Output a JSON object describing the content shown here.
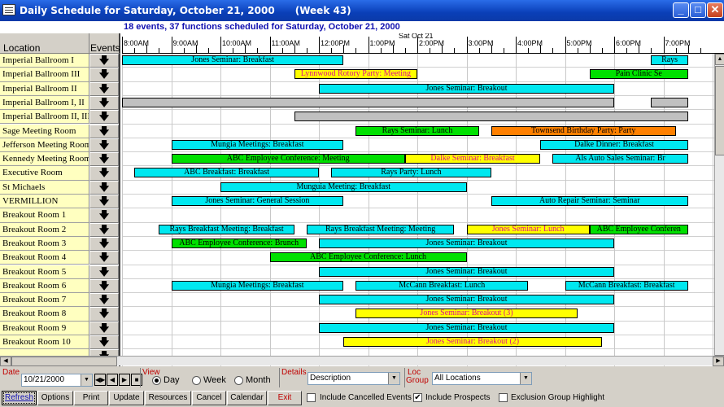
{
  "window": {
    "title": "Daily Schedule for Saturday, October 21, 2000      (Week 43)",
    "min": "_",
    "max": "□",
    "close": "✕"
  },
  "summary": "18 events, 37 functions scheduled for Saturday, October 21, 2000",
  "header": {
    "location": "Location",
    "events": "Events",
    "date": "Sat Oct 21",
    "times": [
      "8:00AM",
      "9:00AM",
      "10:00AM",
      "11:00AM",
      "12:00PM",
      "1:00PM",
      "2:00PM",
      "3:00PM",
      "4:00PM",
      "5:00PM",
      "6:00PM",
      "7:00PM"
    ]
  },
  "locations": [
    "Imperial Ballroom I",
    "Imperial Ballroom III",
    "Imperial Ballroom II",
    "Imperial Ballroom I, II",
    "Imperial Ballroom II, III",
    "Sage Meeting Room",
    "Jefferson Meeting Room",
    "Kennedy Meeting Room",
    "Executive Room",
    "St Michaels",
    "VERMILLION",
    "Breakout Room 1",
    "Breakout Room 2",
    "Breakout Room 3",
    "Breakout Room 4",
    "Breakout Room 5",
    "Breakout Room 6",
    "Breakout Room 7",
    "Breakout Room 8",
    "Breakout Room 9",
    "Breakout Room 10"
  ],
  "event_button": "🡇",
  "bars": [
    {
      "row": 0,
      "start": 8.0,
      "end": 12.5,
      "color": "cyan",
      "label": "Jones Seminar: Breakfast"
    },
    {
      "row": 0,
      "start": 18.75,
      "end": 19.5,
      "color": "cyan",
      "label": "Rays"
    },
    {
      "row": 1,
      "start": 11.5,
      "end": 14.0,
      "color": "yellow",
      "label": "Lynnwood Rotory Party: Meeting"
    },
    {
      "row": 1,
      "start": 17.5,
      "end": 19.5,
      "color": "green",
      "label": "Pain Clinic Se"
    },
    {
      "row": 2,
      "start": 12.0,
      "end": 18.0,
      "color": "cyan",
      "label": "Jones Seminar: Breakout"
    },
    {
      "row": 3,
      "start": 8.0,
      "end": 18.0,
      "color": "grey",
      "label": ""
    },
    {
      "row": 3,
      "start": 18.75,
      "end": 19.5,
      "color": "grey",
      "label": ""
    },
    {
      "row": 4,
      "start": 11.5,
      "end": 19.5,
      "color": "grey",
      "label": ""
    },
    {
      "row": 5,
      "start": 12.75,
      "end": 15.25,
      "color": "green",
      "label": "Rays Seminar: Lunch"
    },
    {
      "row": 5,
      "start": 15.5,
      "end": 19.25,
      "color": "orange",
      "label": "Townsend Birthday Party: Party"
    },
    {
      "row": 6,
      "start": 9.0,
      "end": 12.5,
      "color": "cyan",
      "label": "Mungia Meetings: Breakfast"
    },
    {
      "row": 6,
      "start": 16.5,
      "end": 19.5,
      "color": "cyan",
      "label": "Dalke Dinner: Breakfast"
    },
    {
      "row": 7,
      "start": 9.0,
      "end": 13.75,
      "color": "green",
      "label": "ABC Employee Conference: Meeting"
    },
    {
      "row": 7,
      "start": 13.75,
      "end": 16.5,
      "color": "yellow",
      "label": "Dalke Seminar: Breakfast"
    },
    {
      "row": 7,
      "start": 16.75,
      "end": 19.5,
      "color": "cyan",
      "label": "Als Auto Sales Seminar: Br"
    },
    {
      "row": 8,
      "start": 8.25,
      "end": 12.0,
      "color": "cyan",
      "label": "ABC Breakfast: Breakfast"
    },
    {
      "row": 8,
      "start": 12.25,
      "end": 15.5,
      "color": "cyan",
      "label": "Rays Party: Lunch"
    },
    {
      "row": 9,
      "start": 10.0,
      "end": 15.0,
      "color": "cyan",
      "label": "Munguia Meeting: Breakfast"
    },
    {
      "row": 10,
      "start": 9.0,
      "end": 12.5,
      "color": "cyan",
      "label": "Jones Seminar: General Session"
    },
    {
      "row": 10,
      "start": 15.5,
      "end": 19.5,
      "color": "cyan",
      "label": "Auto Repair Seminar: Seminar"
    },
    {
      "row": 12,
      "start": 8.75,
      "end": 11.5,
      "color": "cyan",
      "label": "Rays Breakfast Meeting: Breakfast"
    },
    {
      "row": 12,
      "start": 11.75,
      "end": 14.75,
      "color": "cyan",
      "label": "Rays Breakfast Meeting: Meeting"
    },
    {
      "row": 12,
      "start": 15.0,
      "end": 17.5,
      "color": "yellow",
      "label": "Jones Seminar: Lunch"
    },
    {
      "row": 12,
      "start": 17.5,
      "end": 19.5,
      "color": "green",
      "label": "ABC Employee Conferen"
    },
    {
      "row": 13,
      "start": 9.0,
      "end": 11.75,
      "color": "green",
      "label": "ABC Employee Conference: Brunch"
    },
    {
      "row": 13,
      "start": 12.0,
      "end": 18.0,
      "color": "cyan",
      "label": "Jones Seminar: Breakout"
    },
    {
      "row": 14,
      "start": 11.0,
      "end": 15.0,
      "color": "green",
      "label": "ABC Employee Conference: Lunch"
    },
    {
      "row": 15,
      "start": 12.0,
      "end": 18.0,
      "color": "cyan",
      "label": "Jones Seminar: Breakout"
    },
    {
      "row": 16,
      "start": 9.0,
      "end": 12.5,
      "color": "cyan",
      "label": "Mungia Meetings: Breakfast"
    },
    {
      "row": 16,
      "start": 12.75,
      "end": 16.25,
      "color": "cyan",
      "label": "McCann Breakfast: Lunch"
    },
    {
      "row": 16,
      "start": 17.0,
      "end": 19.5,
      "color": "cyan",
      "label": "McCann Breakfast: Breakfast"
    },
    {
      "row": 17,
      "start": 12.0,
      "end": 18.0,
      "color": "cyan",
      "label": "Jones Seminar: Breakout"
    },
    {
      "row": 18,
      "start": 12.75,
      "end": 17.25,
      "color": "yellow",
      "label": "Jones Seminar: Breakout (3)"
    },
    {
      "row": 19,
      "start": 12.0,
      "end": 18.0,
      "color": "cyan",
      "label": "Jones Seminar: Breakout"
    },
    {
      "row": 20,
      "start": 12.5,
      "end": 17.75,
      "color": "yellow",
      "label": "Jones Seminar: Breakout (2)"
    }
  ],
  "controls": {
    "date_label": "Date",
    "date_value": "10/21/2000",
    "nav": [
      "◀▶",
      "◀",
      "▶",
      "■"
    ],
    "view_label": "View",
    "view_options": [
      "Day",
      "Week",
      "Month"
    ],
    "view_selected": "Day",
    "details_label": "Details",
    "details_value": "Description",
    "loc_label_1": "Loc",
    "loc_label_2": "Group",
    "loc_value": "All Locations"
  },
  "buttons": [
    "Refresh",
    "Options",
    "Print",
    "Update",
    "Resources",
    "Cancel",
    "Calendar",
    "Exit"
  ],
  "checks": [
    {
      "label": "Include Cancelled Events",
      "checked": false
    },
    {
      "label": "Include Prospects",
      "checked": true
    },
    {
      "label": "Exclusion Group Highlight",
      "checked": false
    }
  ],
  "colors": {
    "cyan": "#00e8f0",
    "green": "#00e000",
    "yellow": "#ffff00",
    "orange": "#ff8000",
    "grey": "#c0c0c0",
    "location_bg": "#ffffc0",
    "summary_text": "#1010b0"
  }
}
